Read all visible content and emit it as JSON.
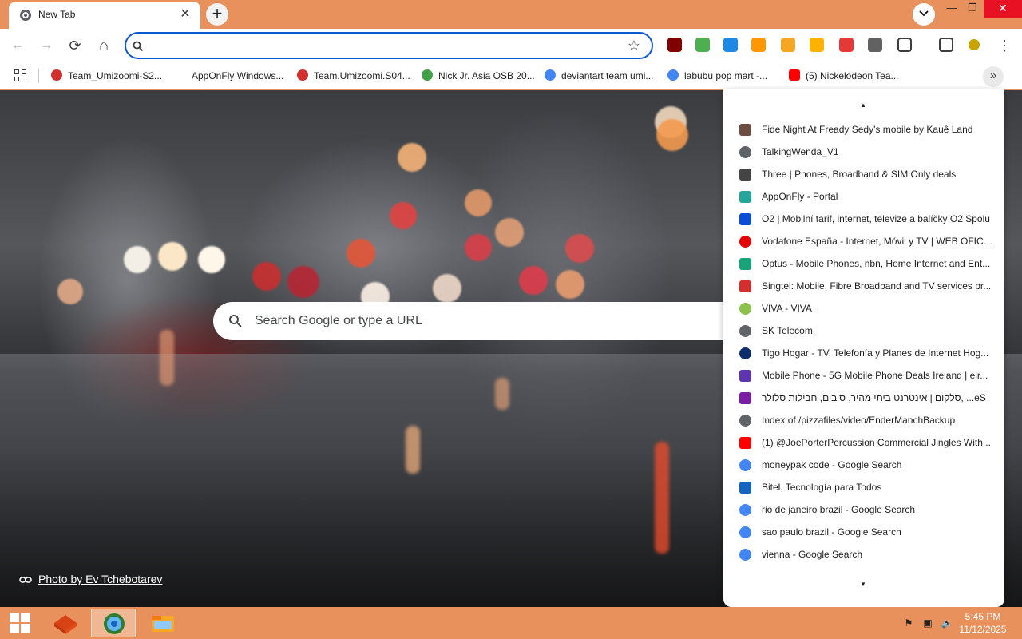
{
  "window": {
    "tab_title": "New Tab",
    "tab_close": "✕",
    "new_tab": "+",
    "minimize": "—",
    "maximize": "❐",
    "close": "✕"
  },
  "toolbar": {
    "back": "←",
    "forward": "→",
    "reload": "⟳",
    "home": "⌂",
    "omnibox_value": "",
    "star": "☆",
    "menu": "⋮"
  },
  "extensions": [
    {
      "name": "ublock-origin-icon",
      "color": "#800000"
    },
    {
      "name": "shield-check-icon",
      "color": "#4caf50"
    },
    {
      "name": "audio-wave-icon",
      "color": "#1e88e5"
    },
    {
      "name": "signal-waves-icon",
      "color": "#ff9800"
    },
    {
      "name": "people-icon",
      "color": "#f5a623"
    },
    {
      "name": "horseshoe-icon",
      "color": "#ffb300"
    },
    {
      "name": "thumbs-down-icon",
      "color": "#e53935"
    },
    {
      "name": "microphone-icon",
      "color": "#616161"
    },
    {
      "name": "puzzle-icon",
      "color": "#3c3c3c"
    },
    {
      "name": "flask-icon",
      "color": "#3c3c3c"
    },
    {
      "name": "profile-avatar-icon",
      "color": "#c8a400"
    }
  ],
  "bookmarks_bar": [
    {
      "label": "Team_Umizoomi-S2...",
      "icon": "youtube-red-icon",
      "color": "#d32f2f"
    },
    {
      "label": "AppOnFly Windows...",
      "icon": "none",
      "color": ""
    },
    {
      "label": "Team.Umizoomi.S04...",
      "icon": "youtube-red-icon",
      "color": "#d32f2f"
    },
    {
      "label": "Nick Jr. Asia OSB 20...",
      "icon": "nick-jr-icon",
      "color": "#43a047"
    },
    {
      "label": "deviantart team umi...",
      "icon": "google-icon",
      "color": "#4285f4"
    },
    {
      "label": "labubu pop mart -...",
      "icon": "google-icon",
      "color": "#4285f4"
    },
    {
      "label": "(5) Nickelodeon Tea...",
      "icon": "youtube-icon",
      "color": "#ff0000"
    }
  ],
  "bookmarks_more": "»",
  "ntp": {
    "search_placeholder": "Search Google or type a URL",
    "photo_credit": "Photo by Ev Tchebotarev"
  },
  "overflow_menu": {
    "scroll_up": "▲",
    "scroll_down": "▼",
    "items": [
      {
        "label": "Fide Night At Fready Sedy's mobile by Kauê Land",
        "icon": "game-thumb-icon",
        "color": "#6d4c41"
      },
      {
        "label": "TalkingWenda_V1",
        "icon": "globe-icon",
        "color": "#5f6368"
      },
      {
        "label": "Three | Phones, Broadband & SIM Only deals",
        "icon": "three-logo-icon",
        "color": "#444"
      },
      {
        "label": "AppOnFly - Portal",
        "icon": "paper-plane-icon",
        "color": "#26a69a"
      },
      {
        "label": "O2 | Mobilní tarif, internet, televize a balíčky O2 Spolu",
        "icon": "o2-icon",
        "color": "#0a4cd6"
      },
      {
        "label": "Vodafone España - Internet, Móvil y TV | WEB OFICI...",
        "icon": "vodafone-icon",
        "color": "#e60000"
      },
      {
        "label": "Optus - Mobile Phones, nbn, Home Internet and Ent...",
        "icon": "optus-icon",
        "color": "#1aa37a"
      },
      {
        "label": "Singtel: Mobile, Fibre Broadband and TV services pr...",
        "icon": "singtel-icon",
        "color": "#d32f2f"
      },
      {
        "label": "VIVA - VIVA",
        "icon": "viva-check-icon",
        "color": "#8bc34a"
      },
      {
        "label": "SK Telecom",
        "icon": "globe-icon",
        "color": "#5f6368"
      },
      {
        "label": "Tigo Hogar - TV, Telefonía y Planes de Internet Hog...",
        "icon": "tigo-icon",
        "color": "#0d2d6b"
      },
      {
        "label": "Mobile Phone - 5G Mobile Phone Deals Ireland | eir...",
        "icon": "eir-icon",
        "color": "#5e35b1"
      },
      {
        "label": "סלקום | אינטרנט ביתי מהיר, סיבים, חבילות סלולר, ...eS",
        "icon": "cellcom-star-icon",
        "color": "#7b1fa2"
      },
      {
        "label": "Index of /pizzafiles/video/EnderManchBackup",
        "icon": "globe-icon",
        "color": "#5f6368"
      },
      {
        "label": "(1) @JoePorterPercussion Commercial Jingles With...",
        "icon": "youtube-icon",
        "color": "#ff0000"
      },
      {
        "label": "moneypak code - Google Search",
        "icon": "google-icon",
        "color": "#4285f4"
      },
      {
        "label": "Bitel, Tecnología para Todos",
        "icon": "bitel-icon",
        "color": "#1565c0"
      },
      {
        "label": "rio de janeiro brazil - Google Search",
        "icon": "google-icon",
        "color": "#4285f4"
      },
      {
        "label": "sao paulo brazil - Google Search",
        "icon": "google-icon",
        "color": "#4285f4"
      },
      {
        "label": "vienna - Google Search",
        "icon": "google-icon",
        "color": "#4285f4"
      }
    ]
  },
  "taskbar": {
    "time": "5:45 PM",
    "date": "11/12/2025",
    "apps": [
      {
        "name": "taskbar-app-red-box",
        "color": "#d84315"
      },
      {
        "name": "taskbar-app-browser",
        "color": "#2e7d32"
      },
      {
        "name": "taskbar-app-file-explorer",
        "color": "#f9a825"
      }
    ]
  }
}
